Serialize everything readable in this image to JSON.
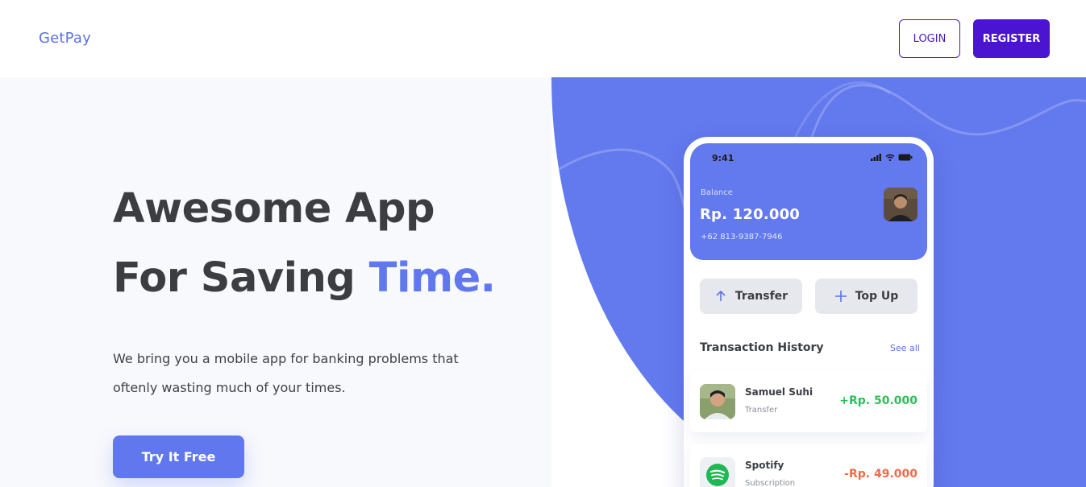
{
  "nav": {
    "brand": "GetPay",
    "login_label": "LOGIN",
    "register_label": "REGISTER"
  },
  "hero": {
    "headline_line1": "Awesome App",
    "headline_line2_prefix": "For Saving ",
    "headline_line2_accent": "Time.",
    "description": "We bring you a mobile app for banking problems that oftenly wasting much of your times.",
    "cta_label": "Try It Free"
  },
  "phone": {
    "time": "9:41",
    "balance_label": "Balance",
    "balance_amount": "Rp. 120.000",
    "phone_number": "+62 813-9387-7946",
    "actions": [
      {
        "label": "Transfer",
        "icon": "arrow-up-icon"
      },
      {
        "label": "Top Up",
        "icon": "plus-icon"
      }
    ],
    "history_title": "Transaction History",
    "see_all": "See all",
    "transactions": [
      {
        "name": "Samuel Suhi",
        "type": "Transfer",
        "amount": "+Rp. 50.000",
        "icon": "user-avatar"
      },
      {
        "name": "Spotify",
        "type": "Subscription",
        "amount": "-Rp. 49.000",
        "icon": "spotify-icon"
      }
    ]
  },
  "colors": {
    "accent": "#6177ee",
    "register": "#4a14d0",
    "positive": "#2bbf5a",
    "negative": "#ef6b45"
  }
}
